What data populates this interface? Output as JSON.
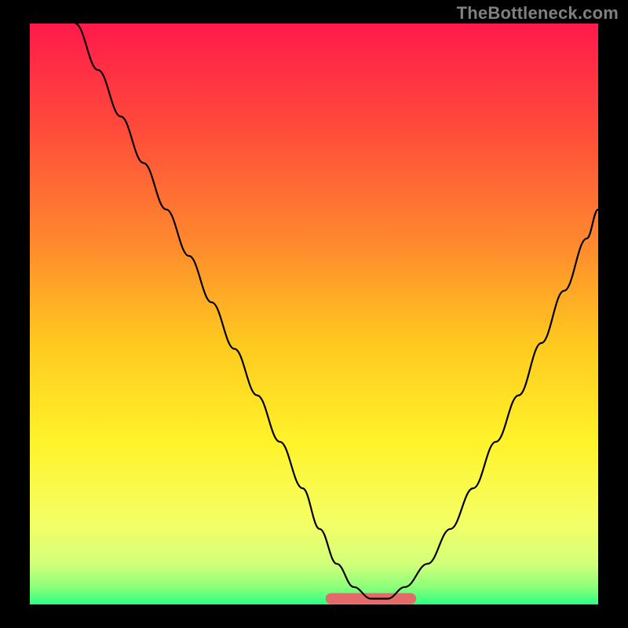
{
  "watermark": "TheBottleneck.com",
  "colors": {
    "frame": "#000000",
    "watermark": "#808080",
    "curve": "#000000",
    "flatband": "#e46a6a",
    "gradient_stops": [
      {
        "offset": 0.0,
        "color": "#ff1a4b"
      },
      {
        "offset": 0.18,
        "color": "#ff4b3a"
      },
      {
        "offset": 0.38,
        "color": "#ff8a2e"
      },
      {
        "offset": 0.55,
        "color": "#ffc91f"
      },
      {
        "offset": 0.72,
        "color": "#fff32a"
      },
      {
        "offset": 0.86,
        "color": "#f4ff66"
      },
      {
        "offset": 0.93,
        "color": "#d2ff7a"
      },
      {
        "offset": 0.97,
        "color": "#8dff7a"
      },
      {
        "offset": 1.0,
        "color": "#2cff83"
      }
    ]
  },
  "chart_data": {
    "type": "line",
    "title": "",
    "xlabel": "",
    "ylabel": "",
    "xlim": [
      0,
      100
    ],
    "ylim": [
      0,
      100
    ],
    "series": [
      {
        "name": "bottleneck-curve",
        "x": [
          8,
          12,
          16,
          20,
          24,
          28,
          32,
          36,
          40,
          44,
          48,
          51,
          54,
          57,
          60,
          63,
          66,
          70,
          74,
          78,
          82,
          86,
          90,
          94,
          98,
          100
        ],
        "y": [
          100,
          92,
          84,
          76,
          68,
          60,
          52,
          44,
          36,
          28,
          20,
          13,
          7,
          3,
          1,
          1,
          3,
          7,
          13,
          20,
          28,
          36,
          45,
          54,
          63,
          68
        ]
      }
    ],
    "annotations": [
      {
        "name": "flat-band",
        "x_start": 53,
        "x_end": 67,
        "y": 1
      }
    ]
  }
}
